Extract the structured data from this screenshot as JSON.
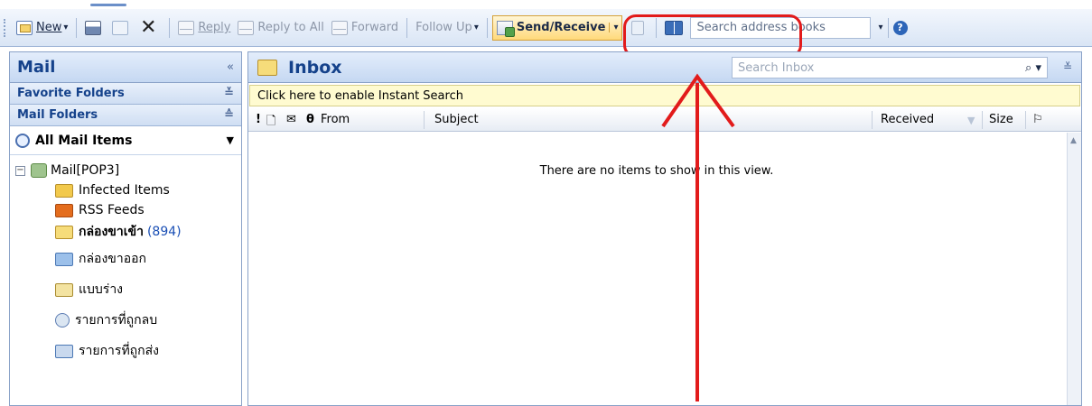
{
  "toolbar": {
    "new_label": "New",
    "reply_label": "Reply",
    "reply_all_label": "Reply to All",
    "forward_label": "Forward",
    "follow_up_label": "Follow Up",
    "send_receive_label": "Send/Receive",
    "search_address_placeholder": "Search address books",
    "icons": [
      "new-mail-icon",
      "print-icon",
      "move-to-folder-icon",
      "delete-icon",
      "reply-icon",
      "reply-all-icon",
      "forward-icon",
      "send-receive-icon",
      "address-book-icon",
      "help-icon"
    ]
  },
  "nav": {
    "title": "Mail",
    "favorite_folders": "Favorite Folders",
    "mail_folders": "Mail Folders",
    "all_mail_items": "All Mail Items",
    "root": "Mail[POP3]",
    "folders": [
      {
        "label": "Infected Items",
        "count": ""
      },
      {
        "label": "RSS Feeds",
        "count": ""
      },
      {
        "label": "กล่องขาเข้า",
        "count": "(894)"
      },
      {
        "label": "กล่องขาออก",
        "count": ""
      },
      {
        "label": "แบบร่าง",
        "count": ""
      },
      {
        "label": "รายการที่ถูกลบ",
        "count": ""
      },
      {
        "label": "รายการที่ถูกส่ง",
        "count": ""
      }
    ]
  },
  "content": {
    "title": "Inbox",
    "search_placeholder": "Search Inbox",
    "instant_search": "Click here to enable Instant Search",
    "columns": {
      "importance": "!",
      "from": "From",
      "subject": "Subject",
      "received": "Received",
      "size": "Size"
    },
    "empty_message": "There are no items to show in this view."
  },
  "colors": {
    "highlight": "#e21b1b",
    "header_text": "#15428b",
    "unread_count": "#1a4fb5"
  }
}
